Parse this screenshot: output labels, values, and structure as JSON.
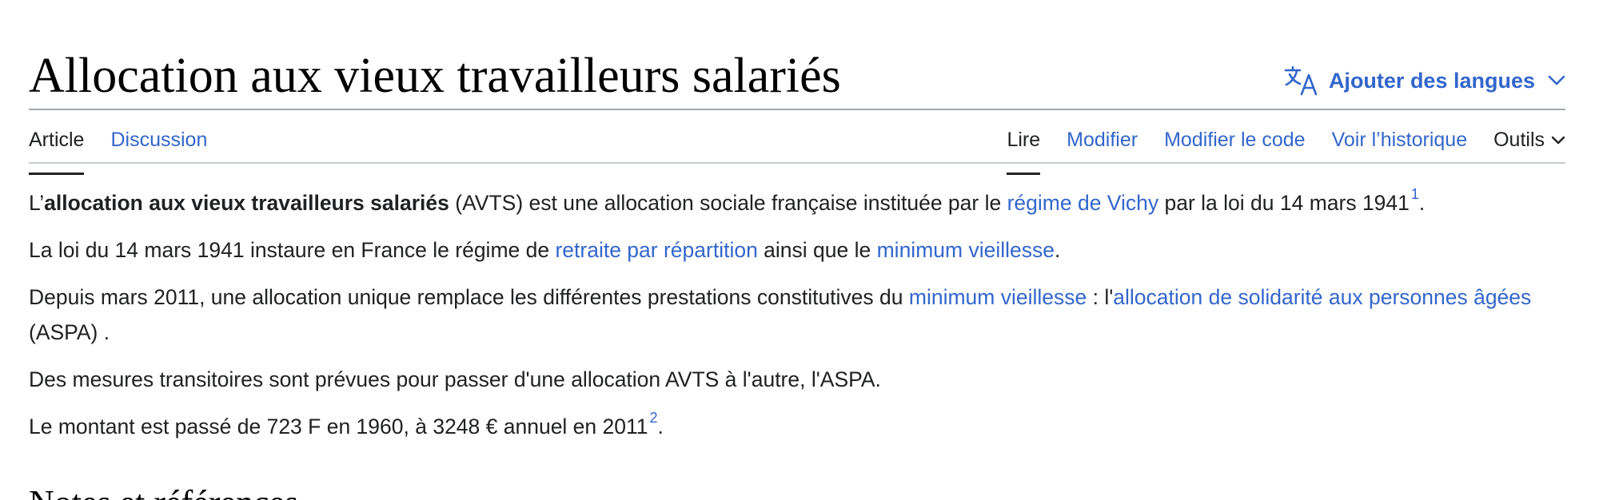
{
  "header": {
    "title": "Allocation aux vieux travailleurs salariés",
    "add_languages_label": "Ajouter des langues",
    "accent_color": "#3366cc"
  },
  "tabs": {
    "left": [
      {
        "label": "Article",
        "active": true
      },
      {
        "label": "Discussion",
        "active": false
      }
    ],
    "right": [
      {
        "label": "Lire",
        "active": true
      },
      {
        "label": "Modifier",
        "active": false
      },
      {
        "label": "Modifier le code",
        "active": false
      },
      {
        "label": "Voir l’historique",
        "active": false
      },
      {
        "label": "Outils",
        "active": false
      }
    ]
  },
  "content": {
    "p1": {
      "prefix": "L’",
      "bold": "allocation aux vieux travailleurs salariés",
      "text1": " (AVTS) est une allocation sociale française instituée par le ",
      "link_vichy": "régime de Vichy",
      "text2": " par la loi du 14 mars 1941",
      "ref": "1",
      "end": "."
    },
    "p2": {
      "text1": "La loi du 14 mars 1941 instaure en France le régime de ",
      "link_retraite": "retraite par répartition",
      "text2": " ainsi que le ",
      "link_minimum": "minimum vieillesse",
      "end": "."
    },
    "p3": {
      "text1": "Depuis mars 2011, une allocation unique remplace les différentes prestations constitutives du ",
      "link_minimum": "minimum vieillesse",
      "text2": " : l'",
      "link_aspa": "allocation de solidarité aux personnes âgées",
      "text3": " (ASPA) ."
    },
    "p4": {
      "text": "Des mesures transitoires sont prévues pour passer d'une allocation AVTS à l'autre, l'ASPA."
    },
    "p5": {
      "text1": "Le montant est passé de 723 F en 1960, à 3248 € annuel en 2011",
      "ref": "2",
      "end": "."
    }
  },
  "section": {
    "heading": "Notes et références"
  }
}
